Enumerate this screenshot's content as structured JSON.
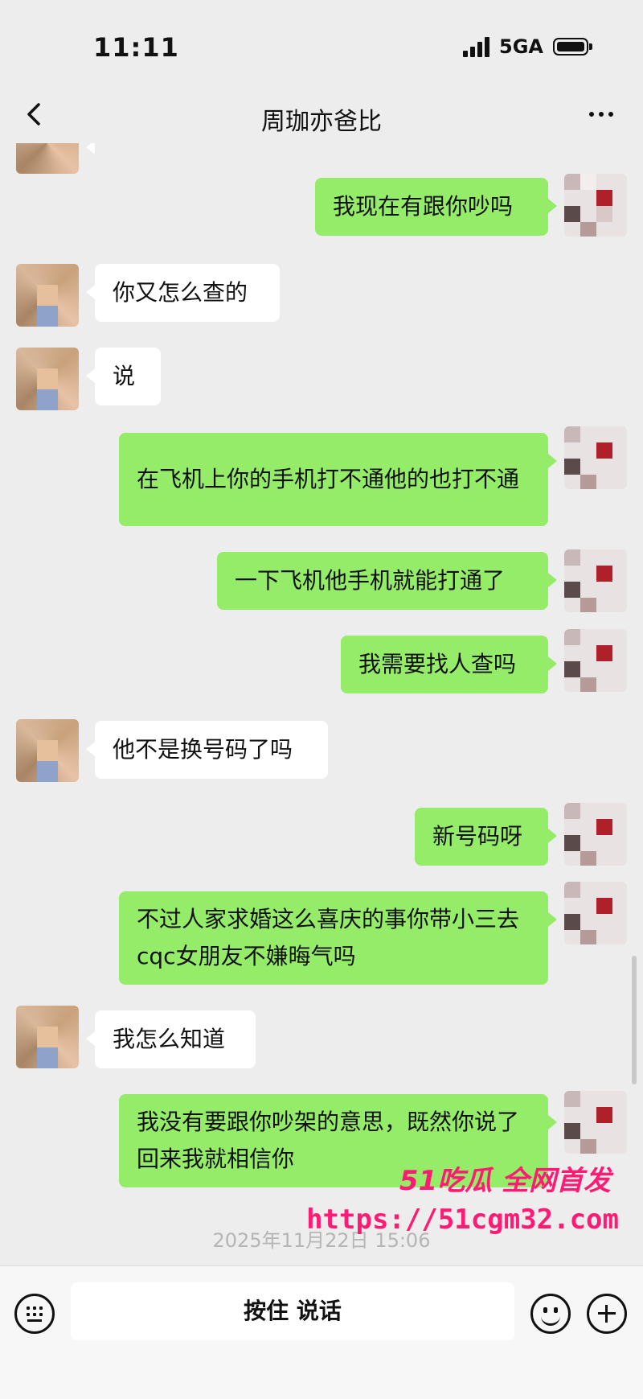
{
  "status_bar": {
    "time": "11:11",
    "network": "5GA",
    "icons": [
      "signal-icon",
      "battery-icon"
    ]
  },
  "nav": {
    "title": "周珈亦爸比",
    "icons": [
      "back-chevron-icon",
      "more-dots-icon"
    ]
  },
  "messages": [
    {
      "side": "out",
      "text": "我现在有跟你吵吗"
    },
    {
      "side": "in",
      "text": "你又怎么查的"
    },
    {
      "side": "in",
      "text": "说"
    },
    {
      "side": "out",
      "text": "在飞机上你的手机打不通他的也打不通"
    },
    {
      "side": "out",
      "text": "一下飞机他手机就能打通了"
    },
    {
      "side": "out",
      "text": "我需要找人查吗"
    },
    {
      "side": "in",
      "text": "他不是换号码了吗"
    },
    {
      "side": "out",
      "text": "新号码呀"
    },
    {
      "side": "out",
      "text": "不过人家求婚这么喜庆的事你带小三去cqc女朋友不嫌晦气吗"
    },
    {
      "side": "in",
      "text": "我怎么知道"
    },
    {
      "side": "out",
      "text": "我没有要跟你吵架的意思，既然你说了回来我就相信你"
    }
  ],
  "timestamp": "2025年11月22日 15:06",
  "watermark": {
    "line1": "51吃瓜 全网首发",
    "line2": "https://51cgm32.com"
  },
  "input_bar": {
    "hold_to_talk": "按住 说话",
    "icons": [
      "keyboard-icon",
      "emoji-icon",
      "plus-icon"
    ]
  }
}
